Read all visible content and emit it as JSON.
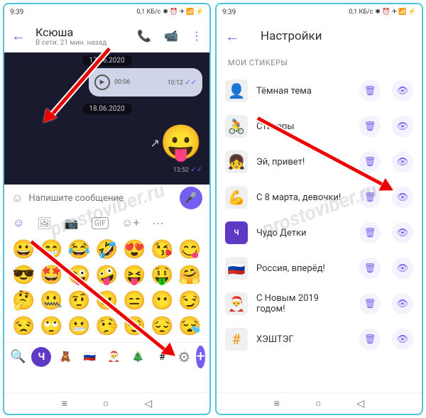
{
  "status": {
    "time": "9:39",
    "net": "0,1 КБ/с",
    "icons": "✱ ⏰ ✈ 📶 ⚡"
  },
  "chat": {
    "name": "Ксюша",
    "last_seen": "В сети: 21 мин. назад",
    "date1": "17.06.2020",
    "date2": "18.06.2020",
    "voice_start": "00:06",
    "voice_end": "10:12",
    "msg_time": "13:52",
    "placeholder": "Напишите сообщение"
  },
  "emojis": [
    "😀",
    "😁",
    "😂",
    "🤣",
    "😍",
    "😘",
    "😋",
    "😎",
    "🤩",
    "😜",
    "🤪",
    "😝",
    "🤑",
    "🤗",
    "🤔",
    "🤐",
    "🤨",
    "😐",
    "😑",
    "😶",
    "😏",
    "😒",
    "🙄",
    "😬",
    "🤥",
    "😌",
    "😔",
    "😪"
  ],
  "sticker_tabs": [
    "Ч",
    "🧸",
    "🇷🇺",
    "🎅",
    "🎄",
    "#"
  ],
  "settings": {
    "title": "Настройки",
    "section": "МОИ СТИКЕРЫ",
    "packs": [
      {
        "thumb": "👤",
        "name": "Тёмная тема"
      },
      {
        "thumb": "🚴",
        "name": "Стикеры"
      },
      {
        "thumb": "👧",
        "name": "Эй, привет!"
      },
      {
        "thumb": "💪",
        "name": "С 8 марта, девочки!"
      },
      {
        "thumb": "Ч",
        "name": "Чудо Детки"
      },
      {
        "thumb": "🇷🇺",
        "name": "Россия, вперёд!"
      },
      {
        "thumb": "🎅",
        "name": "С Новым 2019 годом!"
      },
      {
        "thumb": "#",
        "name": "ХЭШТЭГ"
      }
    ]
  },
  "watermark": "prostoviber.ru"
}
